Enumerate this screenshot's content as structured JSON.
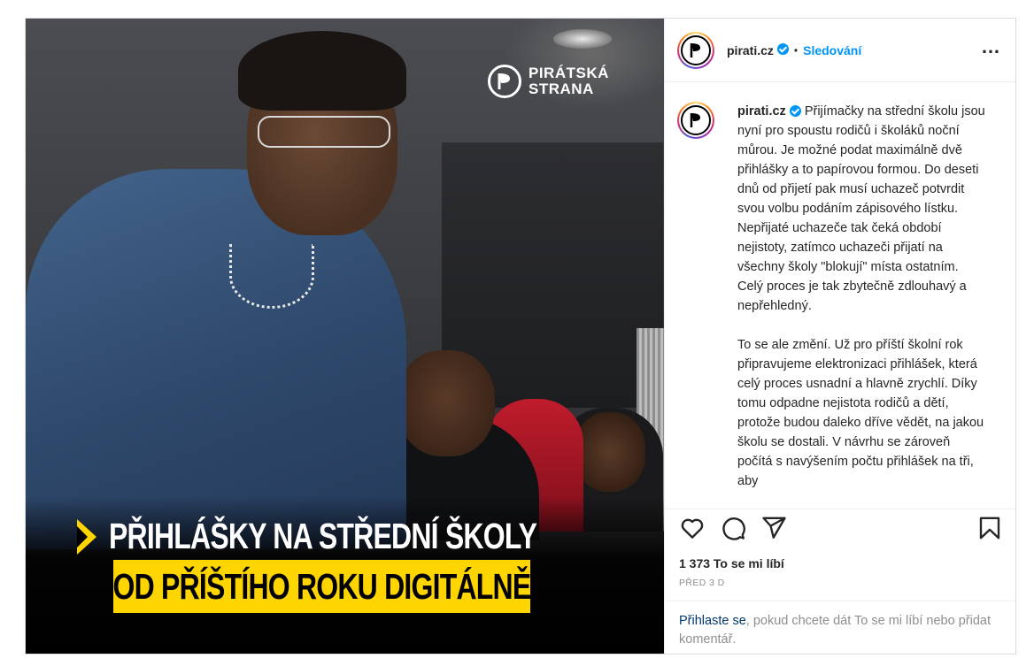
{
  "post": {
    "image": {
      "logo_line1": "PIRÁTSKÁ",
      "logo_line2": "STRANA",
      "headline_line1": "PŘIHLÁŠKY NA STŘEDNÍ ŠKOLY",
      "headline_line2": "OD PŘÍŠTÍHO ROKU DIGITÁLNĚ",
      "accent_color": "#ffd500"
    },
    "header": {
      "username": "pirati.cz",
      "separator": "•",
      "follow_label": "Sledování",
      "more_icon": "…"
    },
    "caption": {
      "username": "pirati.cz",
      "paragraph1": "Přijímačky na střední školu jsou nyní pro spoustu rodičů i školáků noční můrou. Je možné podat maximálně dvě přihlášky a to papírovou formou. Do deseti dnů od přijetí pak musí uchazeč potvrdit svou volbu podáním zápisového lístku. Nepřijaté uchazeče tak čeká období nejistoty, zatímco uchazeči přijatí na všechny školy \"blokují\" místa ostatním. Celý proces je tak zbytečně zdlouhavý a nepřehledný.",
      "paragraph2": "To se ale změní. Už pro příští školní rok připravujeme elektronizaci přihlášek, která celý proces usnadní a hlavně zrychlí. Díky tomu odpadne nejistota rodičů a dětí, protože budou daleko dříve vědět, na jakou školu se dostali. V návrhu se zároveň počítá s navýšením počtu přihlášek na tři, aby"
    },
    "likes_text": "1 373 To se mi líbí",
    "time_text": "PŘED 3 D",
    "login": {
      "link": "Přihlaste se",
      "rest": ", pokud chcete dát To se mi líbí nebo přidat komentář."
    },
    "colors": {
      "link_blue": "#0095f6",
      "text": "#262626",
      "muted": "#8e8e8e"
    }
  }
}
